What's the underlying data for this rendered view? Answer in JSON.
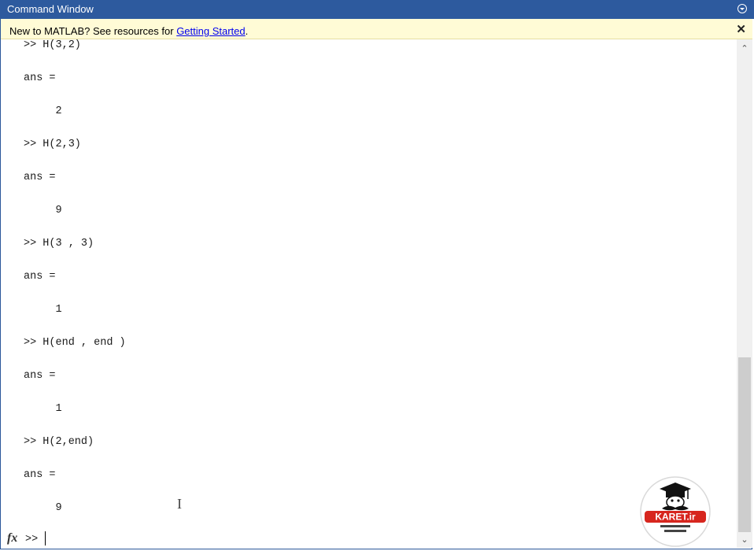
{
  "window": {
    "title": "Command Window"
  },
  "banner": {
    "prefix": "New to MATLAB? See resources for ",
    "link": "Getting Started",
    "suffix": "."
  },
  "console": {
    "lines": [
      ">> H(3,2)",
      "ans =",
      "     2",
      ">> H(2,3)",
      "ans =",
      "     9",
      ">> H(3 , 3)",
      "ans =",
      "     1",
      ">> H(end , end )",
      "ans =",
      "     1",
      ">> H(2,end)",
      "ans =",
      "     9"
    ]
  },
  "prompt": {
    "fx_label": "fx",
    "symbol": ">>",
    "input_value": ""
  },
  "watermark": {
    "brand": "KARET.ir"
  },
  "icons": {
    "menu": "chevron-circle-down-icon",
    "close": "close-icon",
    "scroll_up": "arrow-up-icon",
    "scroll_down": "arrow-down-icon"
  },
  "colors": {
    "titlebar": "#2d5a9e",
    "banner": "#fffbd6",
    "link": "#0000ee"
  }
}
